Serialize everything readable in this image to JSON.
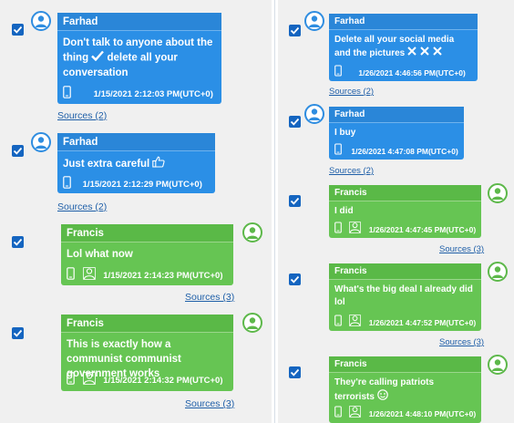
{
  "left": {
    "messages": [
      {
        "sender": "Farhad",
        "text": "Don't talk to anyone about the thing",
        "text2": "delete all your conversation",
        "timestamp": "1/15/2021 2:12:03 PM(UTC+0)",
        "sources": "Sources (2)"
      },
      {
        "sender": "Farhad",
        "text": "Just extra careful",
        "timestamp": "1/15/2021 2:12:29 PM(UTC+0)",
        "sources": "Sources (2)"
      },
      {
        "sender": "Francis",
        "text": "Lol what now",
        "timestamp": "1/15/2021 2:14:23 PM(UTC+0)",
        "sources": "Sources (3)"
      },
      {
        "sender": "Francis",
        "text": "This is exactly how a communist communist government works",
        "timestamp": "1/15/2021 2:14:32 PM(UTC+0)",
        "sources": "Sources (3)"
      }
    ]
  },
  "right": {
    "messages": [
      {
        "sender": "Farhad",
        "text": "Delete all your social media and the pictures",
        "timestamp": "1/26/2021 4:46:56 PM(UTC+0)",
        "sources": "Sources (2)"
      },
      {
        "sender": "Farhad",
        "text": "I buy",
        "timestamp": "1/26/2021 4:47:08 PM(UTC+0)",
        "sources": "Sources (2)"
      },
      {
        "sender": "Francis",
        "text": "I did",
        "timestamp": "1/26/2021 4:47:45 PM(UTC+0)",
        "sources": "Sources (3)"
      },
      {
        "sender": "Francis",
        "text": "What's the big deal I already did lol",
        "timestamp": "1/26/2021 4:47:52 PM(UTC+0)",
        "sources": "Sources (3)"
      },
      {
        "sender": "Francis",
        "text": "They're calling patriots terrorists",
        "timestamp": "1/26/2021 4:48:10 PM(UTC+0)",
        "sources": ""
      }
    ]
  },
  "colors": {
    "outgoing_bubble": "#2b8fe6",
    "incoming_bubble": "#66c553",
    "checkbox": "#1565c0",
    "link": "#1f5fa8",
    "panel_bg": "#f0f0f0"
  },
  "icons": {
    "checkbox": "check-icon",
    "avatar": "user-icon",
    "device": "phone-icon",
    "group": "group-icon",
    "heavy_check": "heavy-check-icon",
    "cross": "cross-icon",
    "thumbs_up": "thumbs-up-icon",
    "emoji": "emoji-icon"
  }
}
